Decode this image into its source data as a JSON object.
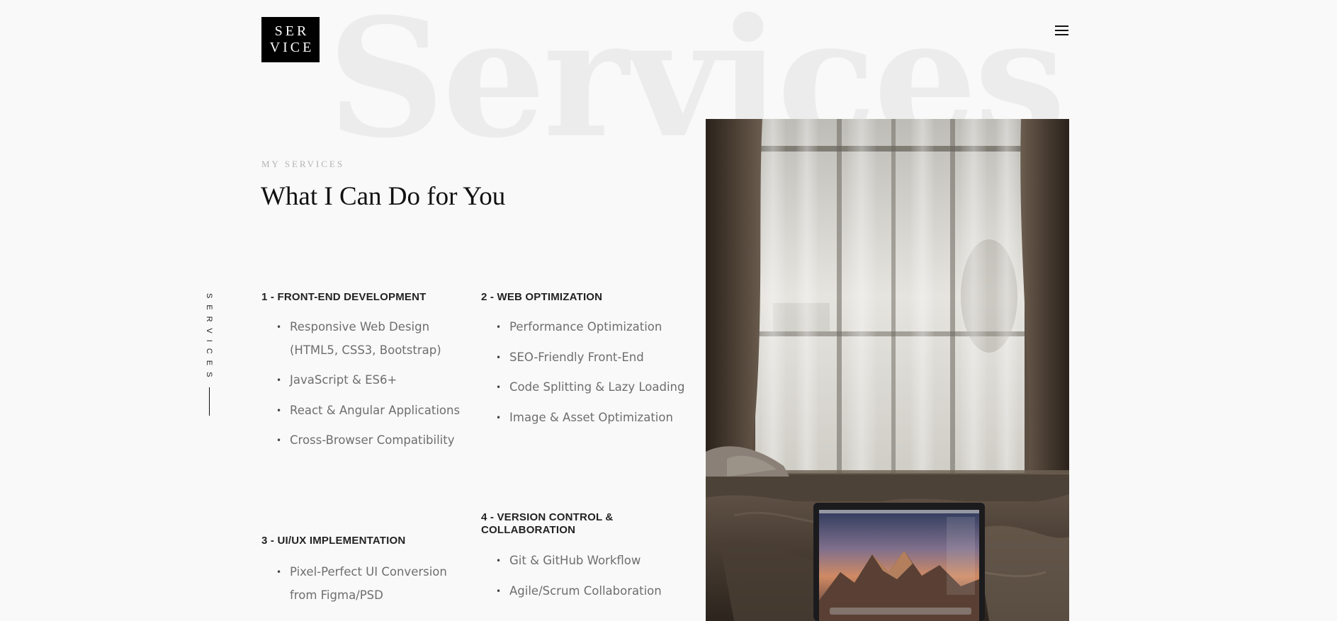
{
  "logo": {
    "line1": "SER",
    "line2": "VICE"
  },
  "header": {
    "menu_icon": "hamburger-menu-icon"
  },
  "watermark": "Services",
  "section": {
    "eyebrow": "MY SERVICES",
    "title": "What I Can Do for You",
    "side_label": "SERVICES"
  },
  "services": [
    {
      "title": "1 - FRONT-END DEVELOPMENT",
      "items": [
        "Responsive Web Design (HTML5, CSS3, Bootstrap)",
        "JavaScript & ES6+",
        "React & Angular Applications",
        "Cross-Browser Compatibility"
      ]
    },
    {
      "title": "2 - WEB OPTIMIZATION",
      "items": [
        "Performance Optimization",
        "SEO-Friendly Front-End",
        "Code Splitting & Lazy Loading",
        "Image & Asset Optimization"
      ]
    },
    {
      "title": "3 - UI/UX IMPLEMENTATION",
      "items": [
        "Pixel-Perfect UI Conversion from Figma/PSD"
      ]
    },
    {
      "title": "4 - VERSION CONTROL & COLLABORATION",
      "items": [
        "Git & GitHub Workflow",
        "Agile/Scrum Collaboration"
      ]
    }
  ],
  "colors": {
    "background": "#f9f9f9",
    "logo_bg": "#000000",
    "watermark": "#ececec",
    "eyebrow": "#b3b3b3",
    "list_text": "#6e6e6e"
  }
}
